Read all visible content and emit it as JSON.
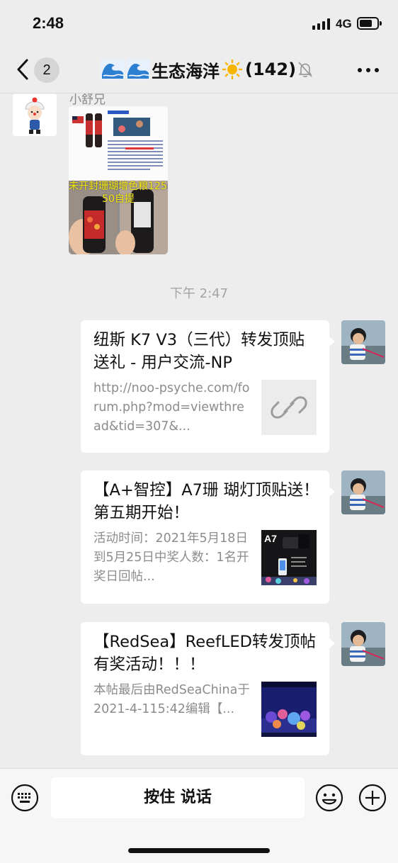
{
  "status_bar": {
    "time": "2:48",
    "network": "4G"
  },
  "header": {
    "back_label": "<",
    "unread_count": "2",
    "title": "生态海洋",
    "member_count": "(142)",
    "icons": [
      "wave-icon",
      "wave-icon",
      "sun-icon",
      "mute-bell-icon",
      "more-icon"
    ]
  },
  "messages": {
    "incoming": {
      "sender": "小舒兄",
      "image_caption_line1": "未开封珊瑚增色粮125ml",
      "image_caption_line2": "50自提"
    },
    "timestamp": "下午 2:47",
    "cards": [
      {
        "title": "纽斯 K7 V3（三代）转发顶贴送礼 - 用户交流-NP",
        "description": "http://noo-psyche.com/forum.php?mod=viewthread&tid=307&...",
        "thumb": "link-icon"
      },
      {
        "title": "【A+智控】A7珊 瑚灯顶贴送！第五期开始！",
        "description": "活动时间：2021年5月18日到5月25日中奖人数：1名开奖日回帖...",
        "thumb_label": "A7"
      },
      {
        "title": "【RedSea】ReefLED转发顶帖有奖活动！！！",
        "description": "本帖最后由RedSeaChina于2021-4-115:42编辑【...",
        "thumb": "reef-tank-photo"
      }
    ]
  },
  "input_bar": {
    "voice_label": "按住 说话"
  },
  "colors": {
    "background": "#ededed",
    "bubble": "#ffffff",
    "muted_text": "#8c8c8c"
  }
}
